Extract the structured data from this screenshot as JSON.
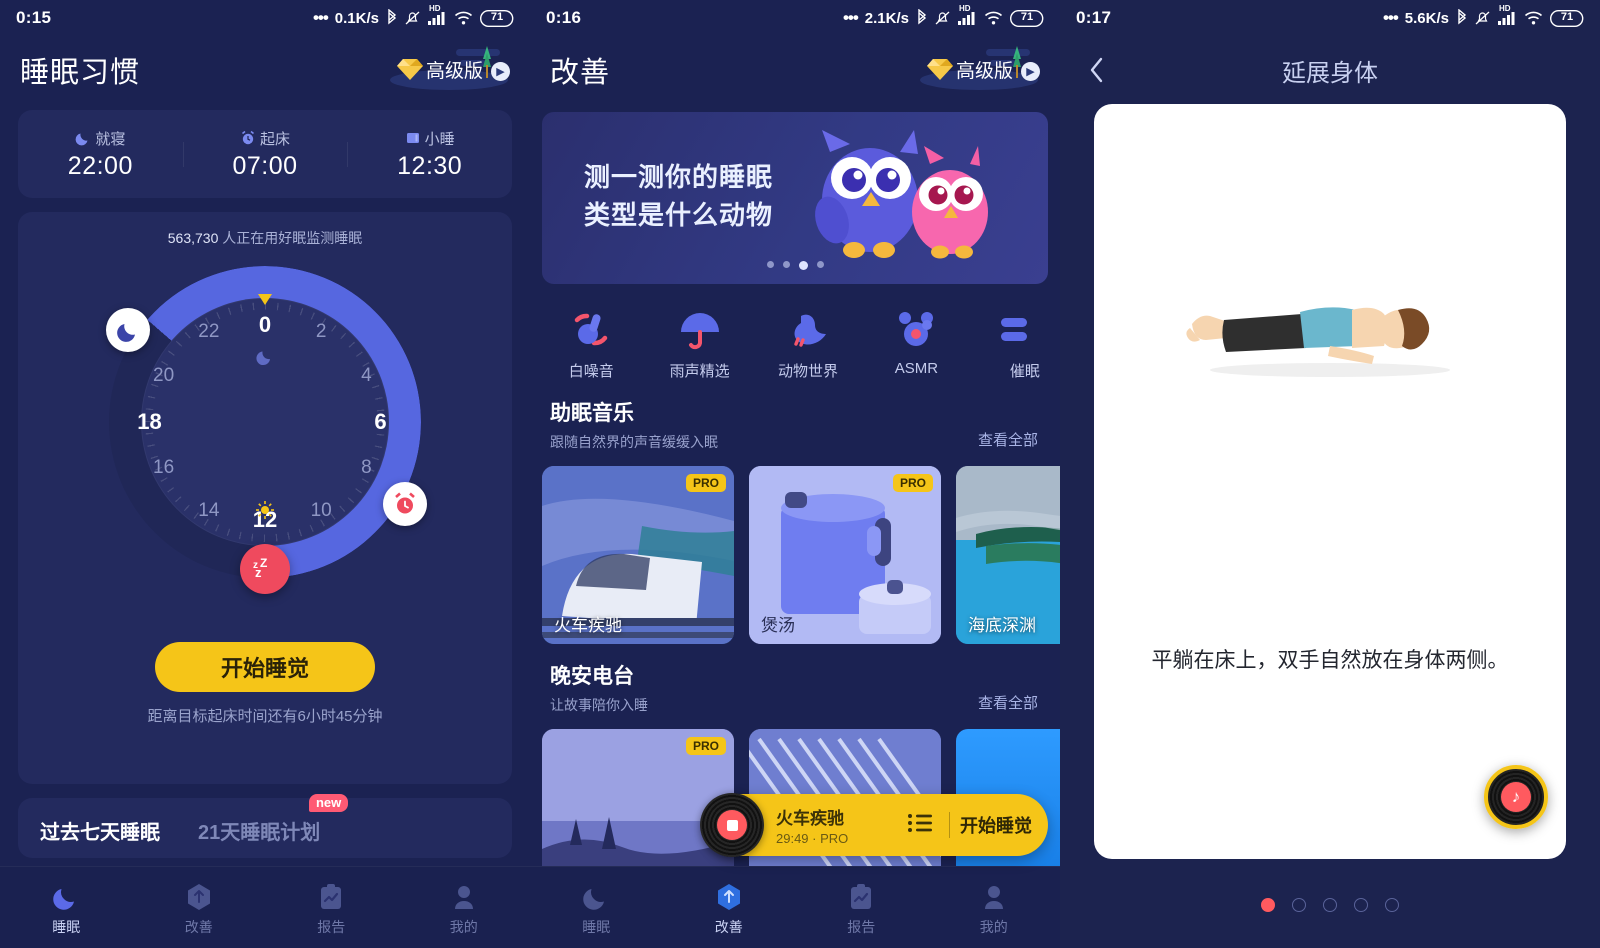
{
  "screen1": {
    "status": {
      "time": "0:15",
      "speed": "0.1K/s",
      "battery": "71",
      "hd": "HD"
    },
    "header": {
      "title": "睡眠习惯",
      "pro_label": "高级版"
    },
    "schedule": [
      {
        "icon": "moon-icon",
        "label": "就寝",
        "time": "22:00"
      },
      {
        "icon": "alarm-icon",
        "label": "起床",
        "time": "07:00"
      },
      {
        "icon": "nap-icon",
        "label": "小睡",
        "time": "12:30"
      }
    ],
    "users_count": "563,730",
    "users_text": "人正在用好眠监测睡眠",
    "dial": {
      "hours": [
        "0",
        "2",
        "4",
        "6",
        "8",
        "10",
        "12",
        "14",
        "16",
        "18",
        "20",
        "22"
      ],
      "bedtime_hour": 22,
      "waketime_hour": 7
    },
    "start_button": "开始睡觉",
    "remaining": "距离目标起床时间还有6小时45分钟",
    "week_tabs": [
      {
        "label": "过去七天睡眠",
        "active": true,
        "badge": ""
      },
      {
        "label": "21天睡眠计划",
        "active": false,
        "badge": "new"
      }
    ],
    "tabbar": [
      {
        "icon": "moon-icon",
        "label": "睡眠",
        "active": true
      },
      {
        "icon": "improve-hexagon-icon",
        "label": "改善",
        "active": false
      },
      {
        "icon": "report-clipboard-icon",
        "label": "报告",
        "active": false
      },
      {
        "icon": "person-icon",
        "label": "我的",
        "active": false
      }
    ]
  },
  "screen2": {
    "status": {
      "time": "0:16",
      "speed": "2.1K/s",
      "battery": "71",
      "hd": "HD"
    },
    "header": {
      "title": "改善",
      "pro_label": "高级版"
    },
    "banner": {
      "line1": "测一测你的睡眠",
      "line2": "类型是什么动物",
      "dots": 4,
      "active_dot": 3
    },
    "categories": [
      {
        "icon": "white-noise-icon",
        "label": "白噪音"
      },
      {
        "icon": "umbrella-rain-icon",
        "label": "雨声精选"
      },
      {
        "icon": "bird-animal-icon",
        "label": "动物世界"
      },
      {
        "icon": "asmr-icon",
        "label": "ASMR"
      },
      {
        "icon": "hypnosis-icon",
        "label": "催眠"
      }
    ],
    "music_section": {
      "title": "助眠音乐",
      "subtitle": "跟随自然界的声音缓缓入眠",
      "more": "查看全部",
      "cards": [
        {
          "caption": "火车疾驰",
          "pro": "PRO"
        },
        {
          "caption": "煲汤",
          "pro": "PRO"
        },
        {
          "caption": "海底深渊",
          "pro": ""
        }
      ]
    },
    "radio_section": {
      "title": "晚安电台",
      "subtitle": "让故事陪你入睡",
      "more": "查看全部",
      "cards": [
        {
          "caption": "",
          "pro": "PRO"
        },
        {
          "caption": "",
          "pro": ""
        },
        {
          "caption": "",
          "pro": ""
        }
      ]
    },
    "player": {
      "title": "火车疾驰",
      "meta": "29:49 · PRO",
      "list_icon": "playlist-icon",
      "action": "开始睡觉"
    },
    "tabbar": [
      {
        "icon": "moon-icon",
        "label": "睡眠",
        "active": false
      },
      {
        "icon": "improve-hexagon-icon",
        "label": "改善",
        "active": true
      },
      {
        "icon": "report-clipboard-icon",
        "label": "报告",
        "active": false
      },
      {
        "icon": "person-icon",
        "label": "我的",
        "active": false
      }
    ]
  },
  "screen3": {
    "status": {
      "time": "0:17",
      "speed": "5.6K/s",
      "battery": "71",
      "hd": "HD"
    },
    "nav": {
      "back_icon": "chevron-left-icon",
      "title": "延展身体"
    },
    "pose_caption": "平躺在床上，双手自然放在身体两侧。",
    "fab_icon": "music-disc-icon",
    "pager": {
      "total": 5,
      "active": 1
    }
  },
  "colors": {
    "background": "#1b2252",
    "card": "#232a5e",
    "accent_yellow": "#f5c518",
    "accent_red": "#ff5a5f",
    "arc_blue": "#5667e0",
    "text_primary": "#ffffff",
    "text_muted": "#98a1cc"
  }
}
